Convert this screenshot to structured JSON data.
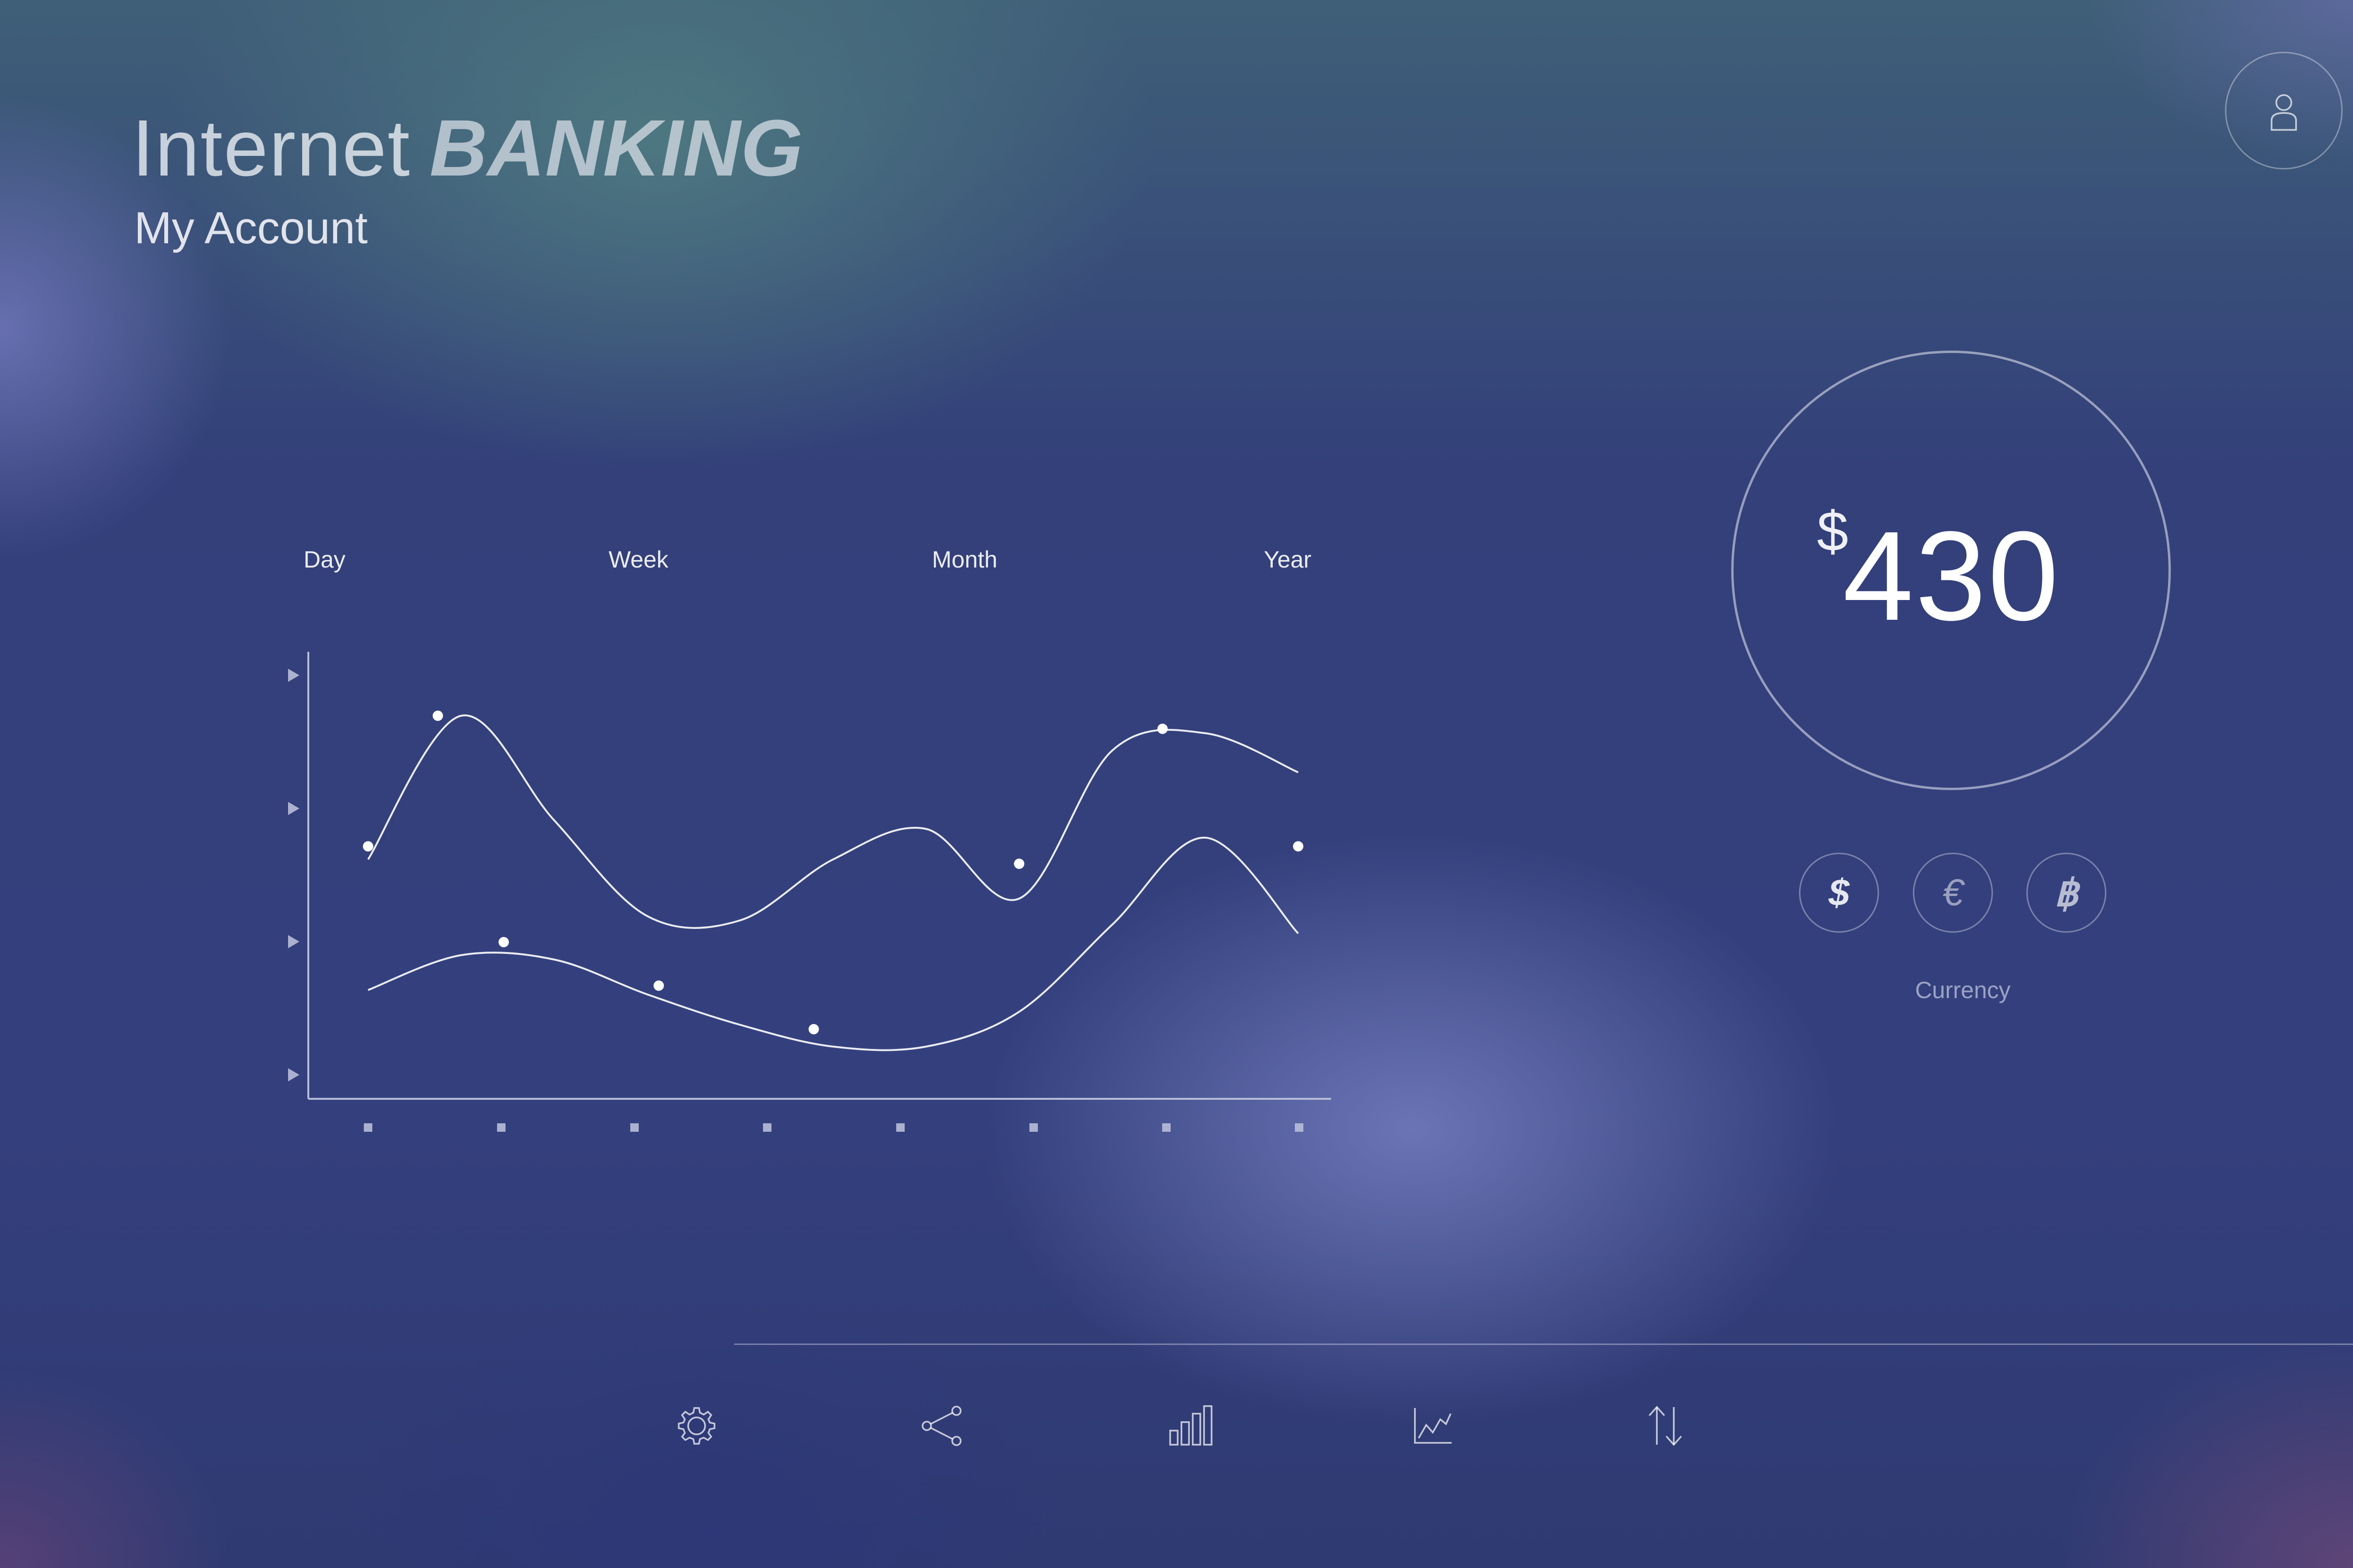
{
  "header": {
    "title_light": "Internet",
    "title_bold": "BANKING",
    "subtitle": "My Account"
  },
  "user": {
    "icon": "user-icon"
  },
  "period_tabs": [
    "Day",
    "Week",
    "Month",
    "Year"
  ],
  "chart_data": {
    "type": "line",
    "series": [
      {
        "values": [
          0.55,
          0.88,
          0.64,
          0.42,
          0.41,
          0.55,
          0.62,
          0.46,
          0.8,
          0.84,
          0.75
        ]
      },
      {
        "values": [
          0.25,
          0.33,
          0.32,
          0.24,
          0.17,
          0.12,
          0.12,
          0.2,
          0.4,
          0.6,
          0.38
        ]
      }
    ],
    "points": [
      [
        [
          0,
          0.58
        ],
        [
          0.18,
          0.88
        ],
        [
          1.68,
          0.54
        ],
        [
          2.05,
          0.85
        ],
        [
          2.4,
          0.58
        ]
      ],
      [
        [
          0.35,
          0.36
        ],
        [
          0.75,
          0.26
        ],
        [
          1.15,
          0.16
        ]
      ]
    ],
    "x_ticks": 8,
    "y_ticks": 4,
    "grid": false,
    "colors": {
      "line": "#ffffff",
      "axis": "#b8bed8"
    }
  },
  "balance": {
    "currency_symbol": "$",
    "amount": "430"
  },
  "currency": {
    "options": [
      {
        "symbol": "$",
        "icon": "dollar-icon"
      },
      {
        "symbol": "€",
        "icon": "euro-icon"
      },
      {
        "symbol": "฿",
        "icon": "bitcoin-icon"
      }
    ],
    "label": "Currency"
  },
  "nav": [
    "gear-icon",
    "share-icon",
    "bar-chart-icon",
    "line-chart-icon",
    "transfer-icon"
  ]
}
